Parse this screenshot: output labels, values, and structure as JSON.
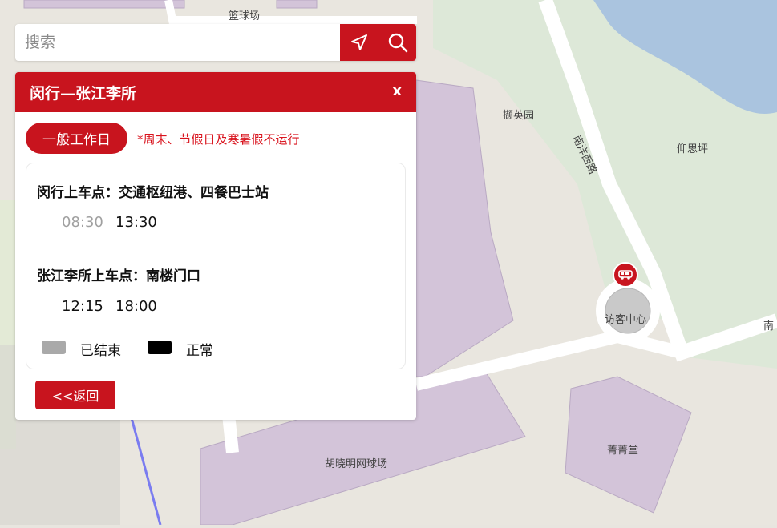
{
  "search": {
    "placeholder": "搜索"
  },
  "panel": {
    "title": "闵行—张江李所",
    "close_label": "x",
    "tab_label": "一般工作日",
    "note": "*周末、节假日及寒暑假不运行",
    "stops": [
      {
        "label": "闵行上车点：交通枢纽港、四餐巴士站",
        "times": [
          "08:30",
          "13:30"
        ],
        "status": [
          "ended",
          "normal"
        ]
      },
      {
        "label": "张江李所上车点：南楼门口",
        "times": [
          "12:15",
          "18:00"
        ],
        "status": [
          "normal",
          "normal"
        ]
      }
    ],
    "legend": [
      {
        "label": "已结束",
        "color": "#a9a9a9"
      },
      {
        "label": "正常",
        "color": "#000000"
      }
    ],
    "back_label": "<<返回"
  },
  "map": {
    "labels": {
      "basketball": "篮球场",
      "xieyingyuan": "撷英园",
      "nanyang_road": "南洋西路",
      "yangsiping": "仰思坪",
      "visitor_center": "访客中心",
      "tennis": "胡晓明网球场",
      "jingjingtang": "菁菁堂",
      "nan_partial": "南"
    },
    "marker_icon": "van-icon"
  },
  "colors": {
    "accent": "#c8141e",
    "building": "#d3c4d9",
    "green": "#dde8d8",
    "road": "#ffffff",
    "water": "#a9c3e0"
  }
}
